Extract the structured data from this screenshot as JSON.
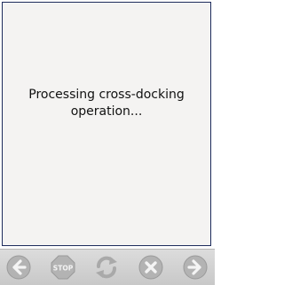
{
  "dialog": {
    "message_line1": "Processing cross-docking",
    "message_line2": "operation..."
  },
  "toolbar": {
    "buttons": [
      {
        "icon": "back-arrow-icon",
        "enabled": false
      },
      {
        "icon": "stop-icon",
        "label": "STOP",
        "enabled": false
      },
      {
        "icon": "refresh-icon",
        "enabled": false
      },
      {
        "icon": "cancel-icon",
        "enabled": false
      },
      {
        "icon": "forward-arrow-icon",
        "enabled": false
      }
    ]
  },
  "colors": {
    "frame_border": "#1d2b5c",
    "panel_background": "#f4f3f2",
    "icon_gray": "#a9a9a9"
  }
}
